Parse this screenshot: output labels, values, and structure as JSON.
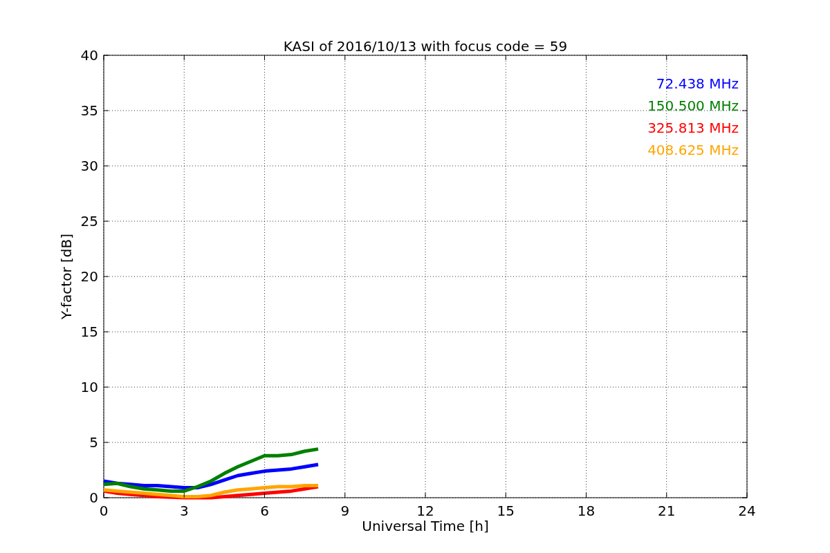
{
  "figure": {
    "chart_data": {
      "type": "line",
      "title": "KASI of 2016/10/13 with focus code = 59",
      "xlabel": "Universal Time [h]",
      "ylabel": "Y-factor [dB]",
      "x": [
        0,
        0.5,
        1,
        1.5,
        2,
        2.5,
        3,
        3.5,
        4,
        4.5,
        5,
        5.5,
        6,
        6.5,
        7,
        7.5,
        8
      ],
      "series": [
        {
          "name": "72.438 MHz",
          "color": "#0000ff",
          "values": [
            1.5,
            1.3,
            1.2,
            1.1,
            1.1,
            1.0,
            0.9,
            0.9,
            1.2,
            1.6,
            2.0,
            2.2,
            2.4,
            2.5,
            2.6,
            2.8,
            3.0
          ]
        },
        {
          "name": "150.500 MHz",
          "color": "#008000",
          "values": [
            1.2,
            1.3,
            1.0,
            0.8,
            0.7,
            0.6,
            0.6,
            1.0,
            1.5,
            2.2,
            2.8,
            3.3,
            3.8,
            3.8,
            3.9,
            4.2,
            4.4
          ]
        },
        {
          "name": "325.813 MHz",
          "color": "#ff0000",
          "values": [
            0.6,
            0.4,
            0.3,
            0.2,
            0.1,
            0.05,
            0.0,
            0.0,
            0.0,
            0.1,
            0.2,
            0.3,
            0.4,
            0.5,
            0.6,
            0.8,
            1.0
          ]
        },
        {
          "name": "408.625 MHz",
          "color": "#ffa500",
          "values": [
            0.7,
            0.6,
            0.5,
            0.4,
            0.3,
            0.2,
            0.1,
            0.1,
            0.2,
            0.5,
            0.7,
            0.8,
            0.9,
            1.0,
            1.0,
            1.1,
            1.1
          ]
        }
      ],
      "grid": true,
      "xlim": [
        0,
        24
      ],
      "ylim": [
        0,
        40
      ],
      "xticks": [
        0,
        3,
        6,
        9,
        12,
        15,
        18,
        21,
        24
      ],
      "yticks": [
        0,
        5,
        10,
        15,
        20,
        25,
        30,
        35,
        40
      ]
    }
  }
}
